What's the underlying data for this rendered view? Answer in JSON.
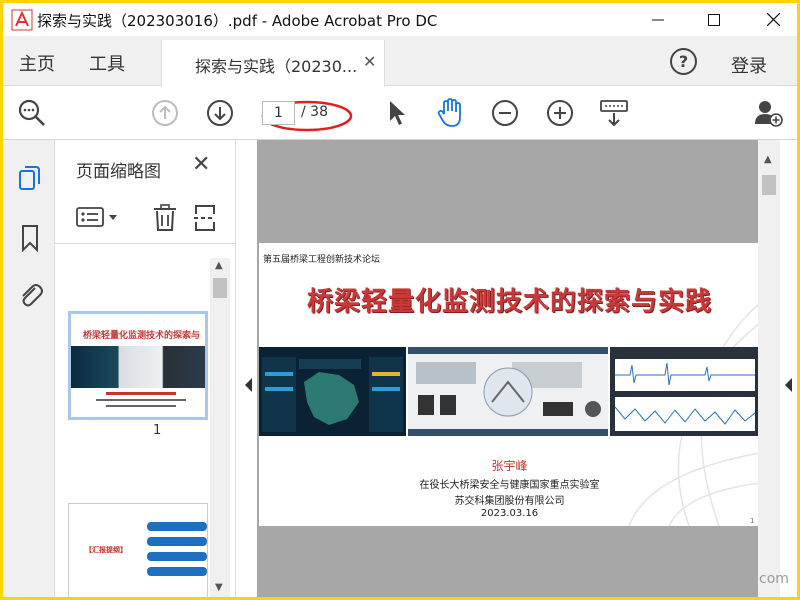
{
  "window": {
    "title": "探索与实践（202303016）.pdf - Adobe Acrobat Pro DC",
    "minimize_icon": "minimize-icon",
    "maximize_icon": "maximize-icon",
    "close_icon": "close-icon"
  },
  "nav": {
    "home": "主页",
    "tools": "工具",
    "doc_tab": "探索与实践（20230...",
    "help": "?",
    "login": "登录"
  },
  "toolbar": {
    "current_page": "1",
    "page_total": "/ 38",
    "icons": [
      "zoom-search-icon",
      "prev-page-icon",
      "next-page-icon",
      "select-cursor-icon",
      "hand-tool-icon",
      "zoom-out-icon",
      "zoom-in-icon",
      "keyboard-tool-icon",
      "share-user-icon"
    ],
    "accent": "#1473e6",
    "annotation_color": "#e02020"
  },
  "panel": {
    "title": "页面缩略图",
    "thumb1_label": "1",
    "thumb1_title": "桥梁轻量化监测技术的探索与",
    "thumb2_label": "【汇报提纲】",
    "thumb2_items": [
      "1",
      "2",
      "3",
      "4"
    ]
  },
  "slide": {
    "forum": "第五届桥梁工程创新技术论坛",
    "title": "桥梁轻量化监测技术的探索与实践",
    "author": "张宇峰",
    "affiliation1": "在役长大桥梁安全与健康国家重点实验室",
    "affiliation2": "苏交科集团股份有限公司",
    "date": "2023.03.16",
    "page_number": "1"
  },
  "watermark": "com"
}
